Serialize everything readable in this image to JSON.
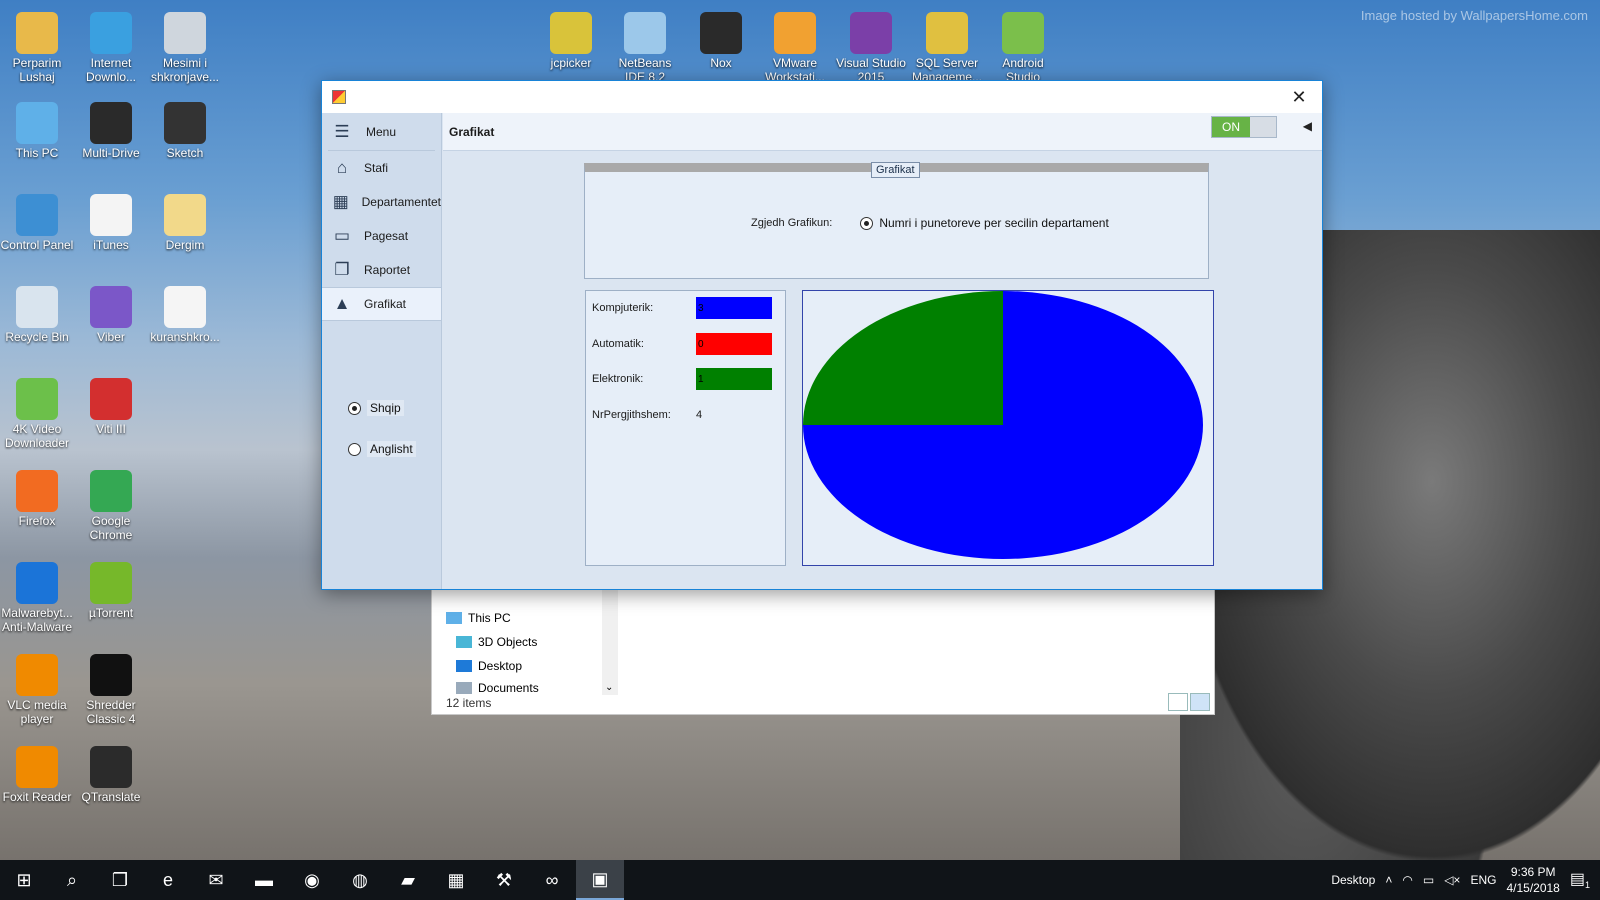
{
  "desktop": {
    "watermark": "Image hosted by WallpapersHome.com",
    "icons": [
      {
        "label": "Perparim Lushaj",
        "color": "#e8b94a"
      },
      {
        "label": "Internet Downlo...",
        "color": "#3aa0e0"
      },
      {
        "label": "Mesimi i shkronjave...",
        "color": "#cfd6dd"
      },
      {
        "label": "This PC",
        "color": "#5fb0e8"
      },
      {
        "label": "Multi-Drive",
        "color": "#2a2a2a"
      },
      {
        "label": "Sketch",
        "color": "#333333"
      },
      {
        "label": "Control Panel",
        "color": "#3d8fd3"
      },
      {
        "label": "iTunes",
        "color": "#f4f4f4"
      },
      {
        "label": "Dergim",
        "color": "#f2d98a"
      },
      {
        "label": "Recycle Bin",
        "color": "#d9e4ee"
      },
      {
        "label": "Viber",
        "color": "#7b57c8"
      },
      {
        "label": "kuranshkro...",
        "color": "#f5f5f5"
      },
      {
        "label": "4K Video Downloader",
        "color": "#6cc04a"
      },
      {
        "label": "Viti III",
        "color": "#d32f2f"
      },
      {
        "label": "Firefox",
        "color": "#f26b21"
      },
      {
        "label": "Google Chrome",
        "color": "#34a853"
      },
      {
        "label": "Malwarebyt... Anti-Malware",
        "color": "#1b74d8"
      },
      {
        "label": "µTorrent",
        "color": "#76b82a"
      },
      {
        "label": "VLC media player",
        "color": "#f08a00"
      },
      {
        "label": "Shredder Classic 4",
        "color": "#111111"
      },
      {
        "label": "Foxit Reader",
        "color": "#f08a00"
      },
      {
        "label": "QTranslate",
        "color": "#2b2b2b"
      },
      {
        "label": "jcpicker",
        "color": "#d9c33a"
      },
      {
        "label": "NetBeans IDE 8.2",
        "color": "#9cc8ea"
      },
      {
        "label": "Nox",
        "color": "#2a2a2a"
      },
      {
        "label": "VMware Workstati...",
        "color": "#f1a131"
      },
      {
        "label": "Visual Studio 2015",
        "color": "#7b3fa8"
      },
      {
        "label": "SQL Server Manageme...",
        "color": "#e0c040"
      },
      {
        "label": "Android Studio",
        "color": "#7bbf4b"
      }
    ]
  },
  "explorer": {
    "nav_items": [
      "This PC",
      "3D Objects",
      "Desktop",
      "Documents"
    ],
    "status": "12 items"
  },
  "app": {
    "sidebar": {
      "menu_label": "Menu",
      "items": [
        {
          "label": "Stafi",
          "icon": "home-icon"
        },
        {
          "label": "Departamentet",
          "icon": "grid-icon"
        },
        {
          "label": "Pagesat",
          "icon": "payment-icon"
        },
        {
          "label": "Raportet",
          "icon": "report-icon"
        },
        {
          "label": "Grafikat",
          "icon": "chart-icon",
          "selected": true
        }
      ],
      "languages": [
        {
          "label": "Shqip",
          "checked": true
        },
        {
          "label": "Anglisht",
          "checked": false
        }
      ]
    },
    "header": {
      "title": "Grafikat",
      "toggle_label": "ON"
    },
    "group": {
      "title": "Grafikat",
      "select_label": "Zgjedh Grafikun:",
      "option_label": "Numri i punetoreve per secilin departament"
    },
    "info": {
      "rows": [
        {
          "label": "Kompjuterik:",
          "value": "3",
          "color": "#0000ff"
        },
        {
          "label": "Automatik:",
          "value": "0",
          "color": "#ff0000"
        },
        {
          "label": "Elektronik:",
          "value": "1",
          "color": "#008000"
        }
      ],
      "total_label": "NrPergjithshem:",
      "total_value": "4"
    }
  },
  "chart_data": {
    "type": "pie",
    "title": "",
    "slices": [
      {
        "label": "Kompjuterik",
        "value": 3,
        "color": "#0000ff"
      },
      {
        "label": "Automatik",
        "value": 0,
        "color": "#ff0000"
      },
      {
        "label": "Elektronik",
        "value": 1,
        "color": "#008000"
      }
    ]
  },
  "taskbar": {
    "apps": [
      "start-icon",
      "search-icon",
      "task-view-icon",
      "edge-icon",
      "mail-icon",
      "explorer-icon",
      "chrome-icon",
      "firefox-icon",
      "notepad-icon",
      "spreadsheet-icon",
      "sqlserver-icon",
      "visualstudio-icon",
      "app-icon"
    ],
    "desktop_label": "Desktop",
    "language": "ENG",
    "time": "9:36 PM",
    "date": "4/15/2018",
    "notification_count": "1"
  }
}
